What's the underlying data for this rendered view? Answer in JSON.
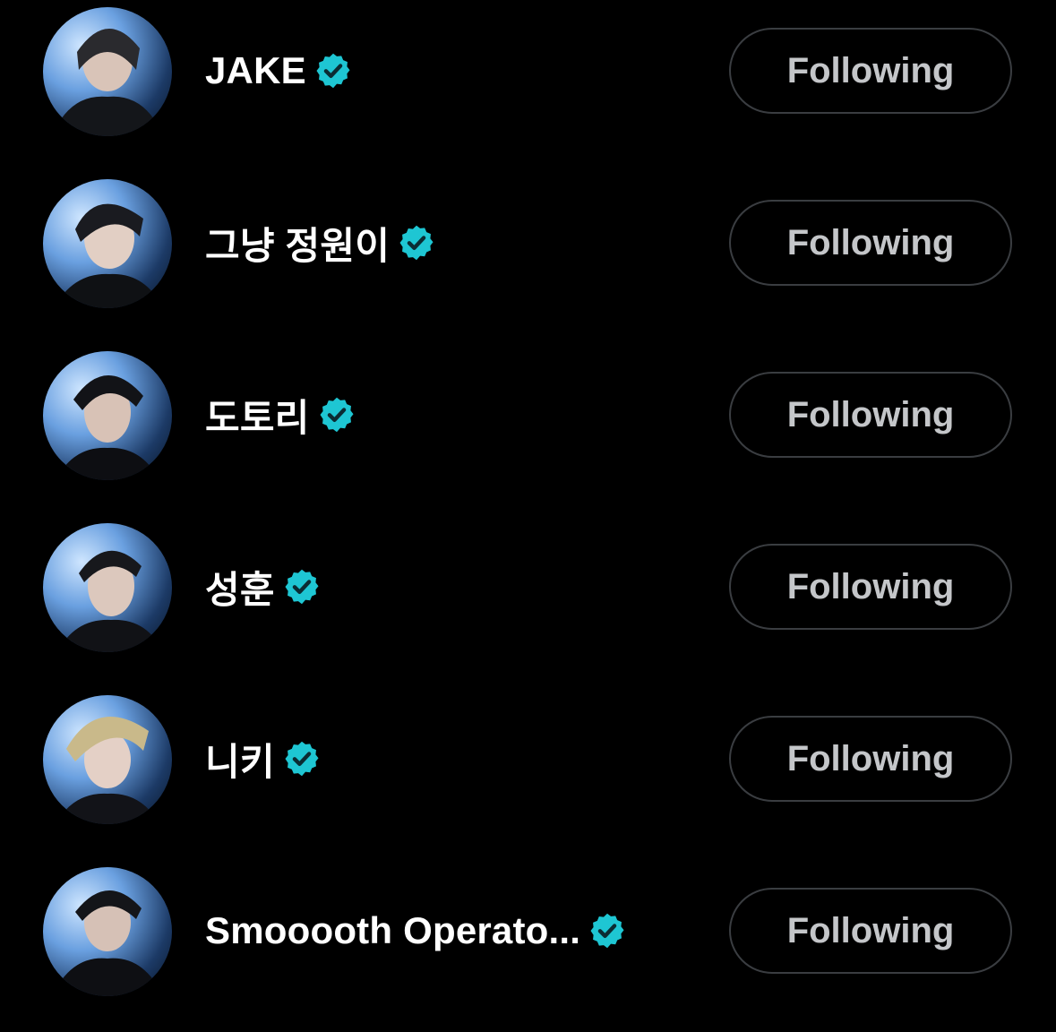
{
  "colors": {
    "background": "#000000",
    "name_text": "#ffffff",
    "button_border": "#3a3d41",
    "button_text": "#c4c6c9",
    "verified_badge": "#1ec6d3"
  },
  "accounts": [
    {
      "name": "JAKE",
      "verified": true,
      "button_label": "Following",
      "avatar_icon": "profile-photo"
    },
    {
      "name": "그냥 정원이",
      "verified": true,
      "button_label": "Following",
      "avatar_icon": "profile-photo"
    },
    {
      "name": "도토리",
      "verified": true,
      "button_label": "Following",
      "avatar_icon": "profile-photo"
    },
    {
      "name": "성훈",
      "verified": true,
      "button_label": "Following",
      "avatar_icon": "profile-photo"
    },
    {
      "name": "니키",
      "verified": true,
      "button_label": "Following",
      "avatar_icon": "profile-photo"
    },
    {
      "name": "Smooooth Operato...",
      "verified": true,
      "button_label": "Following",
      "avatar_icon": "profile-photo"
    }
  ]
}
